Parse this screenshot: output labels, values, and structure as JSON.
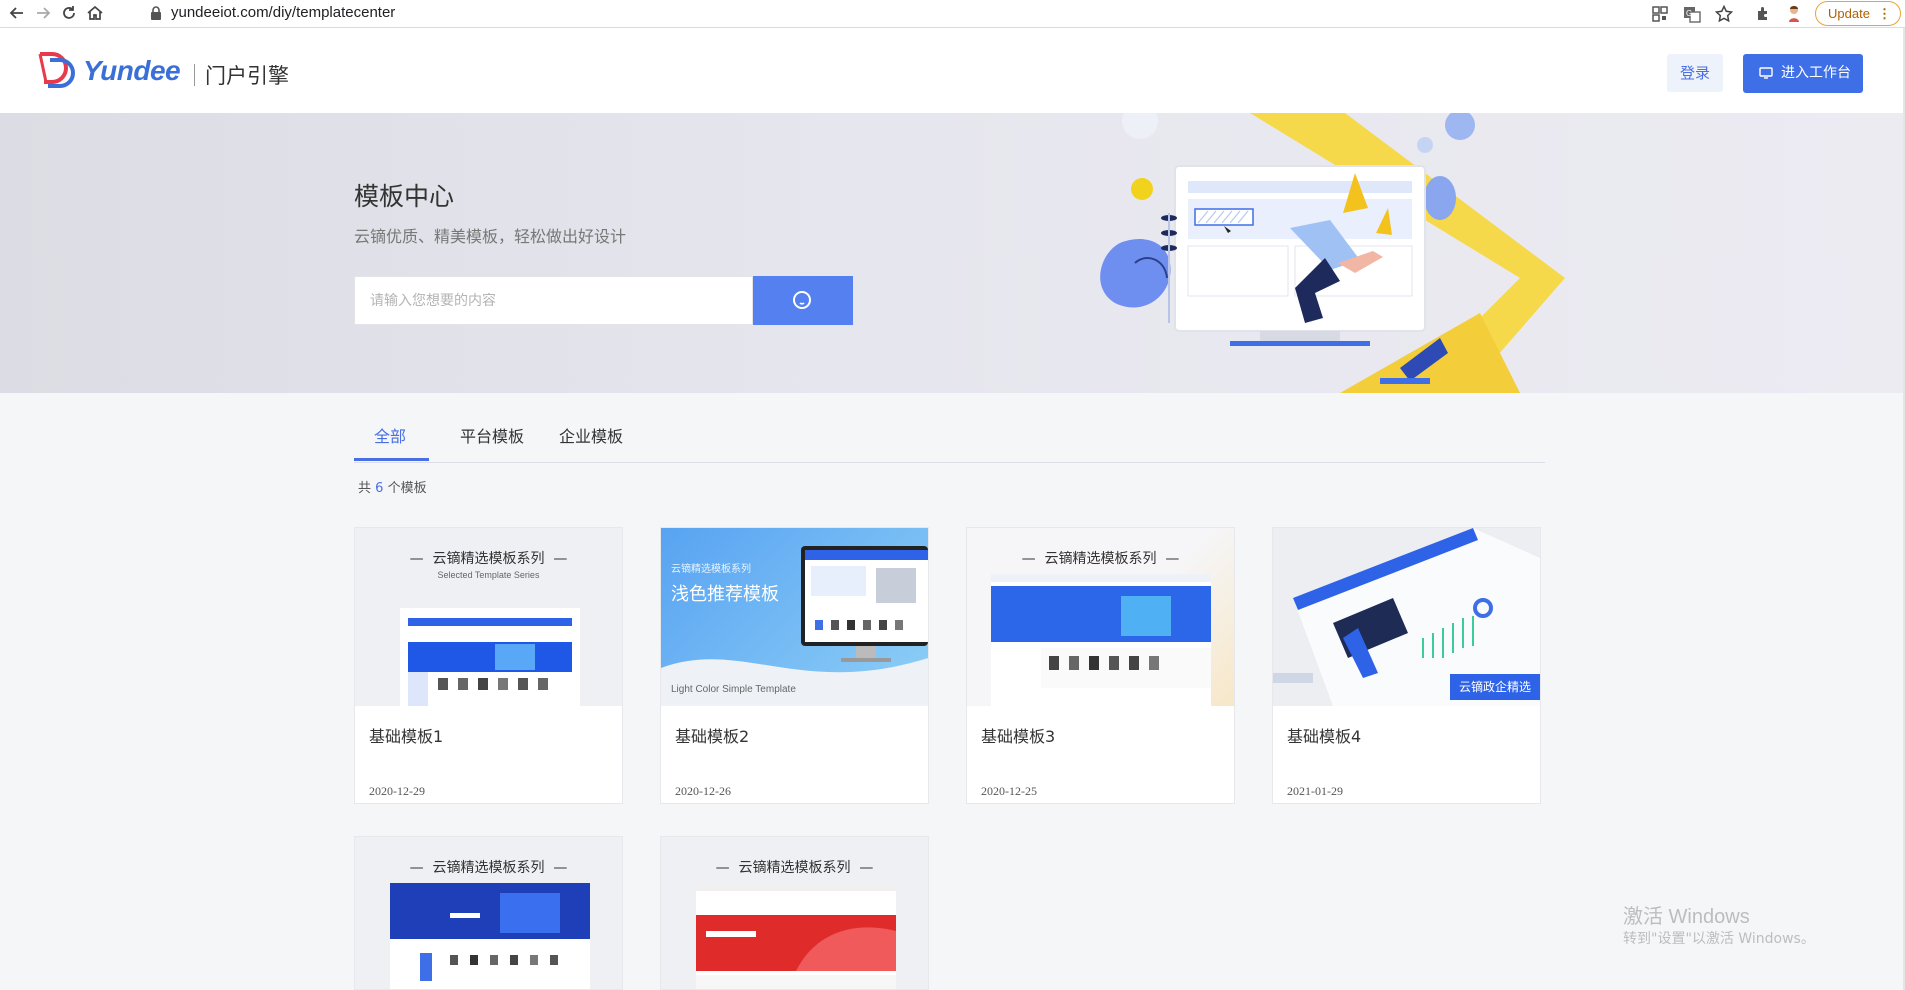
{
  "browser": {
    "url": "yundeeiot.com/diy/templatecenter",
    "update_label": "Update",
    "menu_dots": "⋮",
    "icons": [
      "back-icon",
      "forward-icon",
      "reload-icon",
      "home-icon",
      "lock-icon",
      "qr-icon",
      "translate-icon",
      "star-icon",
      "extensions-icon",
      "profile-icon"
    ]
  },
  "header": {
    "logo_text": "Yundee",
    "logo_sub": "门户引擎",
    "login_label": "登录",
    "workbench_label": "进入工作台",
    "accent": "#3f6fe6"
  },
  "banner": {
    "title": "模板中心",
    "subtitle": "云镝优质、精美模板，轻松做出好设计",
    "search_placeholder": "请输入您想要的内容"
  },
  "tabs": [
    {
      "label": "全部",
      "active": true
    },
    {
      "label": "平台模板",
      "active": false
    },
    {
      "label": "企业模板",
      "active": false
    }
  ],
  "count": {
    "prefix": "共",
    "num": "6",
    "suffix": "个模板"
  },
  "cards": [
    {
      "name": "基础模板1",
      "date": "2020-12-29",
      "series": "云镝精选模板系列",
      "series_en": "Selected Template Series"
    },
    {
      "name": "基础模板2",
      "date": "2020-12-26",
      "series_small": "云镝精选模板系列",
      "headline": "浅色推荐模板",
      "footer_en": "Light Color Simple Template"
    },
    {
      "name": "基础模板3",
      "date": "2020-12-25",
      "series": "云镝精选模板系列"
    },
    {
      "name": "基础模板4",
      "date": "2021-01-29",
      "corner": "云镝政企精选"
    },
    {
      "series": "云镝精选模板系列"
    },
    {
      "series": "云镝精选模板系列"
    }
  ],
  "watermark": {
    "line1": "激活 Windows",
    "line2": "转到\"设置\"以激活 Windows。"
  }
}
